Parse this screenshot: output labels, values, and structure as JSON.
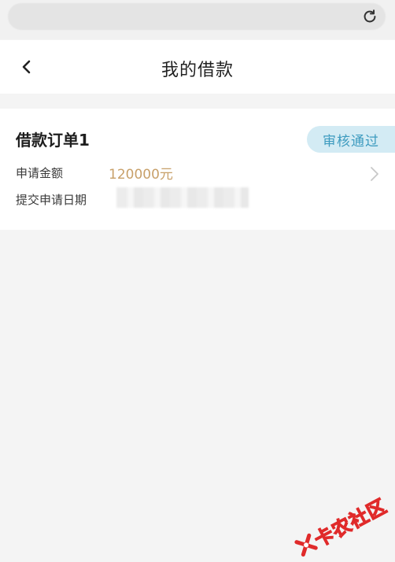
{
  "browser": {
    "reload_icon": "reload-icon"
  },
  "nav": {
    "back_icon": "chevron-left-icon",
    "title": "我的借款"
  },
  "loan": {
    "title": "借款订单1",
    "status": "审核通过",
    "amount_label": "申请金额",
    "amount_value": "120000元",
    "date_label": "提交申请日期",
    "chevron_icon": "chevron-right-icon"
  },
  "watermark": {
    "text": "卡农社区"
  },
  "colors": {
    "status_bg": "#d3ebf4",
    "status_text": "#3d9bbf",
    "amount": "#c8a069",
    "watermark_red": "#e02a2a"
  }
}
